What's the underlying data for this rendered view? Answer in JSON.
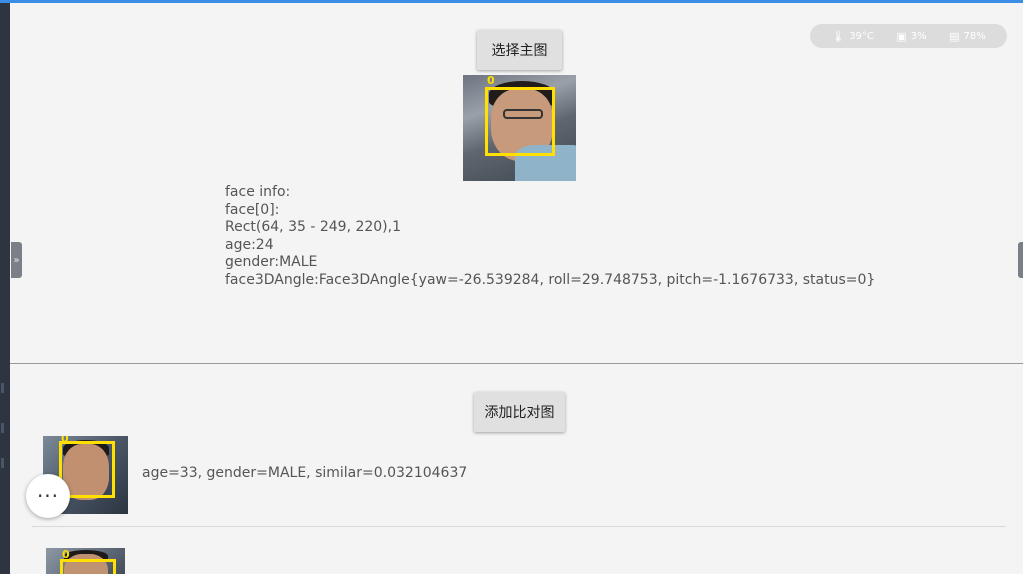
{
  "status": {
    "temperature": "39°C",
    "cpu": "3%",
    "memory": "78%"
  },
  "main": {
    "select_button": "选择主图",
    "face_label": "0",
    "info_lines": [
      "face info:",
      "",
      "face[0]:",
      "Rect(64, 35 - 249, 220),1",
      "age:24",
      "gender:MALE",
      "face3DAngle:Face3DAngle{yaw=-26.539284, roll=29.748753, pitch=-1.1676733, status=0}"
    ]
  },
  "compare": {
    "add_button": "添加比对图",
    "items": [
      {
        "face_label": "0",
        "result": "age=33, gender=MALE, similar=0.032104637"
      },
      {
        "face_label": "0",
        "result": ""
      }
    ]
  },
  "fab": {
    "icon": "more-dots-icon",
    "glyph": "···"
  },
  "handles": {
    "left": "»",
    "right": "‹"
  },
  "colors": {
    "face_box": "#ffe000",
    "top_bar": "#3b8ee6"
  }
}
